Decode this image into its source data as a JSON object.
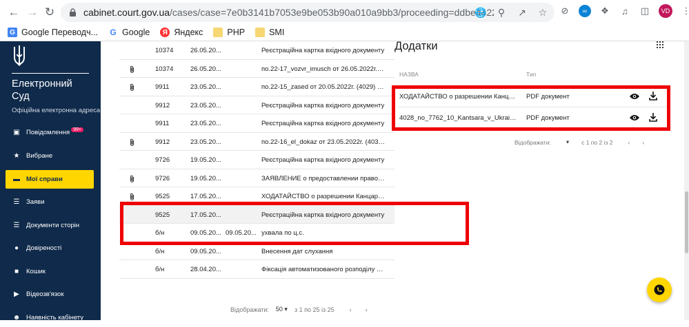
{
  "browser": {
    "url_main": "cabinet.court.gov.ua",
    "url_rest": "/cases/case=7e0b3141b7053e9be053b90a010a9bb3/proceeding=ddbe4422bc68b87be...",
    "profile_initials": "VD",
    "bookmarks": [
      {
        "label": "Google Переводч...",
        "icon": "google-translate-icon"
      },
      {
        "label": "Google",
        "icon": "google-icon"
      },
      {
        "label": "Яндекс",
        "icon": "yandex-icon"
      },
      {
        "label": "PHP",
        "icon": "folder-icon"
      },
      {
        "label": "SMI",
        "icon": "folder-icon"
      }
    ]
  },
  "sidebar": {
    "brand_line1": "Електронний",
    "brand_line2": "Суд",
    "brand_sub": "Офіційна електронна адреса",
    "items": [
      {
        "label": "Повідомлення",
        "badge": "99+",
        "icon": "chat-icon"
      },
      {
        "label": "Вибране",
        "icon": "star-icon"
      },
      {
        "label": "Мої справи",
        "icon": "folder-icon",
        "active": true
      },
      {
        "label": "Заяви",
        "icon": "list-icon"
      },
      {
        "label": "Документи сторін",
        "icon": "list-icon"
      },
      {
        "label": "Довіреності",
        "icon": "people-icon"
      },
      {
        "label": "Кошик",
        "icon": "trash-icon"
      },
      {
        "label": "Відеозв'язок",
        "icon": "video-icon"
      },
      {
        "label": "Наявність кабінету",
        "icon": "person-icon"
      }
    ]
  },
  "proceedings": {
    "rows": [
      {
        "clip": false,
        "num": "10374",
        "date": "26.05.20...",
        "date2": "",
        "desc": "Реєстраційна картка вхідного документу"
      },
      {
        "clip": true,
        "num": "10374",
        "date": "26.05.20...",
        "date2": "",
        "desc": "по.22-17_vozvr_imusch от 26.05.2022г. (..."
      },
      {
        "clip": true,
        "num": "9911",
        "date": "23.05.20...",
        "date2": "",
        "desc": "по.22-15_zased от 20.05.2022г. (4029) Х..."
      },
      {
        "clip": false,
        "num": "9912",
        "date": "23.05.20...",
        "date2": "",
        "desc": "Реєстраційна картка вхідного документу"
      },
      {
        "clip": false,
        "num": "9911",
        "date": "23.05.20...",
        "date2": "",
        "desc": "Реєстраційна картка вхідного документу"
      },
      {
        "clip": true,
        "num": "9912",
        "date": "23.05.20...",
        "date2": "",
        "desc": "по.22-16_el_dokaz от 23.05.2022г. (4030..."
      },
      {
        "clip": false,
        "num": "9726",
        "date": "19.05.20...",
        "date2": "",
        "desc": "Реєстраційна картка вхідного документу"
      },
      {
        "clip": true,
        "num": "9726",
        "date": "19.05.20...",
        "date2": "",
        "desc": "ЗАЯВЛЕНИЕ о предоставлении правов..."
      },
      {
        "clip": true,
        "num": "9525",
        "date": "17.05.20...",
        "date2": "",
        "desc": "ХОДАТАЙСТВО о разрешении Канцара ..."
      },
      {
        "clip": false,
        "num": "9525",
        "date": "17.05.20...",
        "date2": "",
        "desc": "Реєстраційна картка вхідного документу",
        "highlight": true
      },
      {
        "clip": false,
        "num": "б/н",
        "date": "09.05.20...",
        "date2": "09.05.20...",
        "desc": "ухвала по ц.с."
      },
      {
        "clip": false,
        "num": "б/н",
        "date": "09.05.20...",
        "date2": "",
        "desc": "Внесення дат слухання"
      },
      {
        "clip": false,
        "num": "б/н",
        "date": "28.04.20...",
        "date2": "",
        "desc": "Фіксація автоматизованого розподілу сп..."
      }
    ],
    "pager_label": "Відображати:",
    "pager_size": "50",
    "pager_range": "з 1 по 25 із 25"
  },
  "attachments": {
    "title": "Додатки",
    "col_name": "НАЗВА",
    "col_type": "Тип",
    "rows": [
      {
        "name": "ХОДАТАЙСТВО о разрешении Канцара...",
        "type": "PDF документ"
      },
      {
        "name": "4028_no_7762_10_Kantsara_v_Ukraine...",
        "type": "PDF документ"
      }
    ],
    "pager_label": "Відображати:",
    "pager_range": "с 1 по 2 із 2"
  },
  "colors": {
    "sidebar_bg": "#0f2a4a",
    "accent": "#ffd600",
    "highlight_box": "#ee0000",
    "badge": "#e91e63"
  }
}
